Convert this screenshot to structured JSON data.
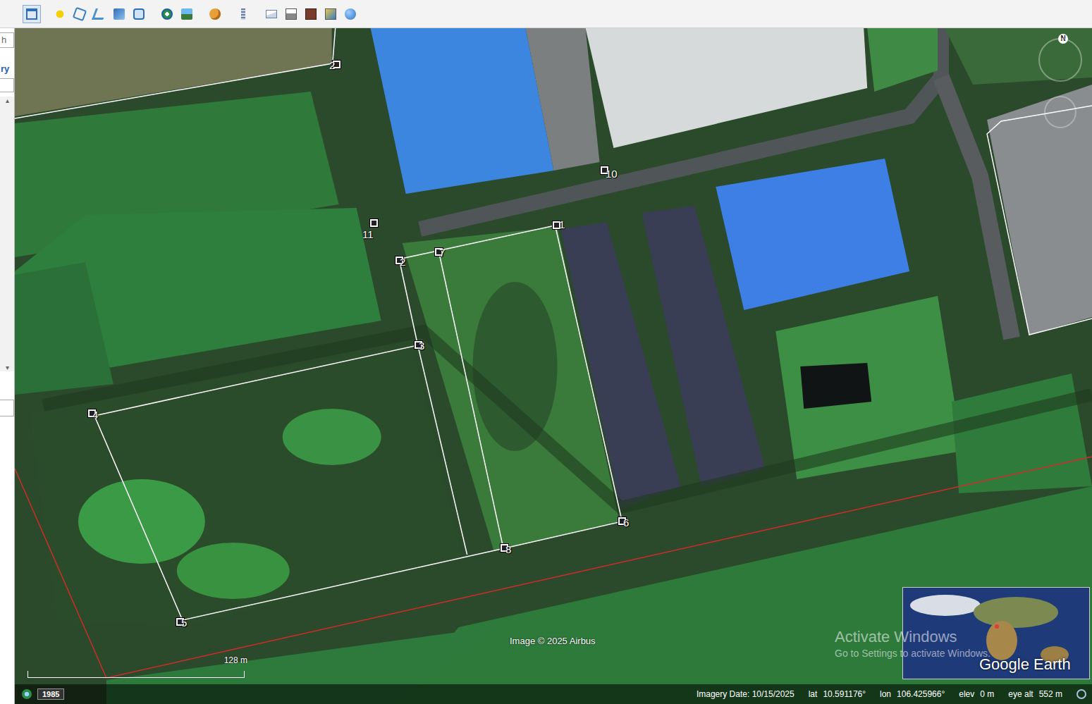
{
  "window": {
    "title": "Google Earth"
  },
  "sidebar": {
    "fragments": [
      "h",
      "ry"
    ]
  },
  "map": {
    "markers": [
      {
        "label": "2"
      },
      {
        "label": "11"
      },
      {
        "label": "10"
      },
      {
        "label": "1"
      },
      {
        "label": "2"
      },
      {
        "label": "7"
      },
      {
        "label": "3"
      },
      {
        "label": "4"
      },
      {
        "label": "5"
      },
      {
        "label": "8"
      },
      {
        "label": "6"
      }
    ],
    "compass": "N",
    "attribution": "Image © 2025 Airbus",
    "scale": "128 m",
    "watermark": {
      "title": "Activate Windows",
      "subtitle": "Go to Settings to activate Windows."
    },
    "logo": "Google Earth"
  },
  "status_bar": {
    "year": "1985",
    "imagery_date": "Imagery Date: 10/15/2025",
    "fields": [
      {
        "label": "lat",
        "value": "10.591176°"
      },
      {
        "label": "lon",
        "value": "106.425966°"
      },
      {
        "label": "elev",
        "value": "0 m"
      },
      {
        "label": "eye alt",
        "value": "552 m"
      }
    ]
  }
}
